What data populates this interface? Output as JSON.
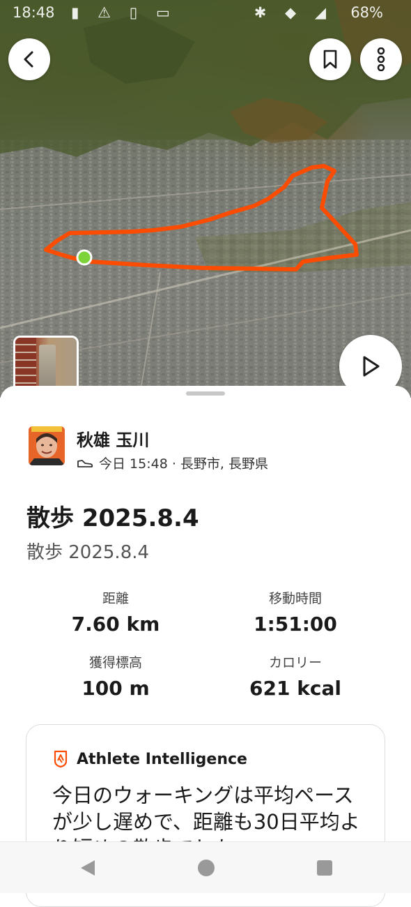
{
  "status_bar": {
    "time": "18:48",
    "battery": "68%"
  },
  "map": {
    "route_color": "#fc4c02",
    "start_marker_color": "#7cd33a"
  },
  "header_buttons": {
    "back_icon": "chevron-left-icon",
    "bookmark_icon": "bookmark-icon",
    "more_icon": "more-vertical-icon",
    "play_icon": "play-icon"
  },
  "athlete": {
    "name": "秋雄 玉川",
    "meta": "今日 15:48 · 長野市, 長野県",
    "activity_icon": "shoe-icon"
  },
  "activity": {
    "title": "散歩 2025.8.4",
    "description": "散歩 2025.8.4"
  },
  "stats": {
    "distance": {
      "label": "距離",
      "value": "7.60 km"
    },
    "moving_time": {
      "label": "移動時間",
      "value": "1:51:00"
    },
    "elevation": {
      "label": "獲得標高",
      "value": "100 m"
    },
    "calories": {
      "label": "カロリー",
      "value": "621 kcal"
    }
  },
  "athlete_intelligence": {
    "title": "Athlete Intelligence",
    "body": "今日のウォーキングは平均ペースが少し遅めで、距離も30日平均より短めの散歩でした。"
  },
  "colors": {
    "brand": "#fc4c02",
    "text": "#1a1a1a"
  }
}
